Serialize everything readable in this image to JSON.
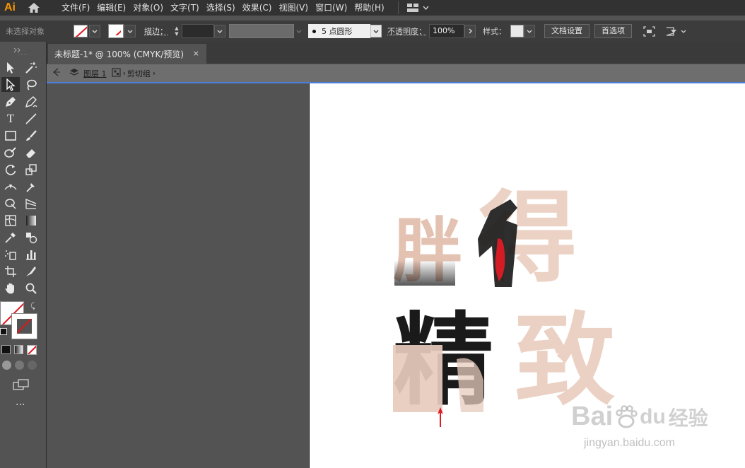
{
  "app": {
    "logo": "Ai"
  },
  "menu": {
    "items": [
      "文件(F)",
      "编辑(E)",
      "对象(O)",
      "文字(T)",
      "选择(S)",
      "效果(C)",
      "视图(V)",
      "窗口(W)",
      "帮助(H)"
    ]
  },
  "control": {
    "no_selection": "未选择对象",
    "stroke_label": "描边：",
    "brush_label": "5 点圆形",
    "opacity_label": "不透明度：",
    "opacity_value": "100%",
    "style_label": "样式：",
    "doc_settings": "文档设置",
    "preferences": "首选项"
  },
  "tab": {
    "title": "未标题-1* @ 100% (CMYK/预览)",
    "close": "×"
  },
  "breadcrumb": {
    "layer": "图层 1",
    "group": "剪切组"
  },
  "artwork": {
    "glyphs": [
      "胖",
      "得",
      "精",
      "致"
    ],
    "colors": {
      "peach": "#ead0c3",
      "dark": "#1a1a1a",
      "red": "#d31c24"
    }
  },
  "watermark": {
    "brand": "Bai",
    "brand2": "du",
    "suffix": "经验",
    "url": "jingyan.baidu.com"
  },
  "toolbar": {
    "more": "···"
  }
}
